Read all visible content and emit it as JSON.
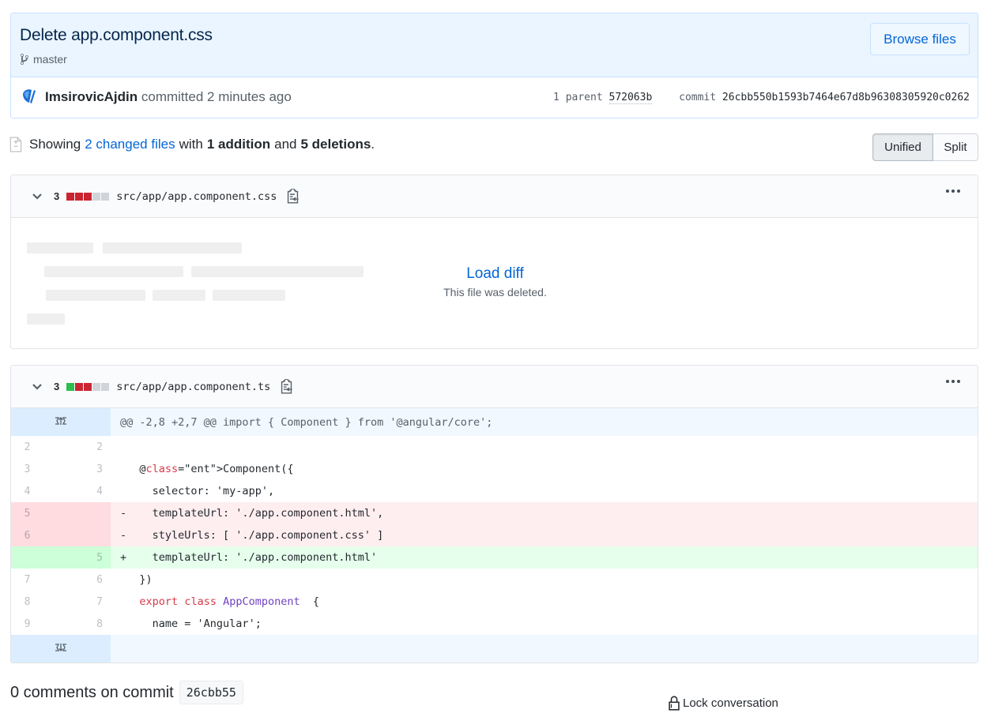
{
  "commit": {
    "title": "Delete app.component.css",
    "branch": "master",
    "branch_icon": "git-branch-icon",
    "browse_files_label": "Browse files",
    "author": "ImsirovicAjdin",
    "action": "committed",
    "time": "2 minutes ago",
    "parent_label": "1 parent",
    "parent_sha": "572063b",
    "commit_label": "commit",
    "commit_sha": "26cbb550b1593b7464e67d8b96308305920c0262"
  },
  "summary": {
    "prefix": "Showing",
    "changed_files": "2 changed files",
    "with": "with",
    "additions": "1 addition",
    "and": "and",
    "deletions": "5 deletions",
    "suffix": ".",
    "view_modes": [
      {
        "label": "Unified",
        "selected": true
      },
      {
        "label": "Split",
        "selected": false
      }
    ]
  },
  "files": [
    {
      "path": "src/app/app.component.css",
      "changes": "3",
      "diffstat": [
        "del",
        "del",
        "del",
        "neu",
        "neu"
      ],
      "load_diff_label": "Load diff",
      "load_diff_note": "This file was deleted."
    },
    {
      "path": "src/app/app.component.ts",
      "changes": "3",
      "diffstat": [
        "add",
        "del",
        "del",
        "neu",
        "neu"
      ],
      "hunk_header": "@@ -2,8 +2,7 @@ import { Component } from '@angular/core';",
      "lines": [
        {
          "type": "ctx",
          "old": "2",
          "new": "2",
          "marker": " ",
          "code": ""
        },
        {
          "type": "ctx",
          "old": "3",
          "new": "3",
          "marker": " ",
          "code": "@Component({"
        },
        {
          "type": "ctx",
          "old": "4",
          "new": "4",
          "marker": " ",
          "code": "  selector: 'my-app',"
        },
        {
          "type": "del",
          "old": "5",
          "new": "",
          "marker": "-",
          "code": "  templateUrl: './app.component.html',"
        },
        {
          "type": "del",
          "old": "6",
          "new": "",
          "marker": "-",
          "code": "  styleUrls: [ './app.component.css' ]"
        },
        {
          "type": "add",
          "old": "",
          "new": "5",
          "marker": "+",
          "code": "  templateUrl: './app.component.html'"
        },
        {
          "type": "ctx",
          "old": "7",
          "new": "6",
          "marker": " ",
          "code": "})"
        },
        {
          "type": "ctx",
          "old": "8",
          "new": "7",
          "marker": " ",
          "code": "export class AppComponent  {"
        },
        {
          "type": "ctx",
          "old": "9",
          "new": "8",
          "marker": " ",
          "code": "  name = 'Angular';"
        }
      ]
    }
  ],
  "comments": {
    "title": "0 comments on commit",
    "short_sha": "26cbb55",
    "lock_label": "Lock conversation"
  },
  "colors": {
    "link": "#0366d6",
    "addition": "#2cbe4e",
    "deletion": "#cb2431",
    "header_bg": "#eaf5ff"
  }
}
